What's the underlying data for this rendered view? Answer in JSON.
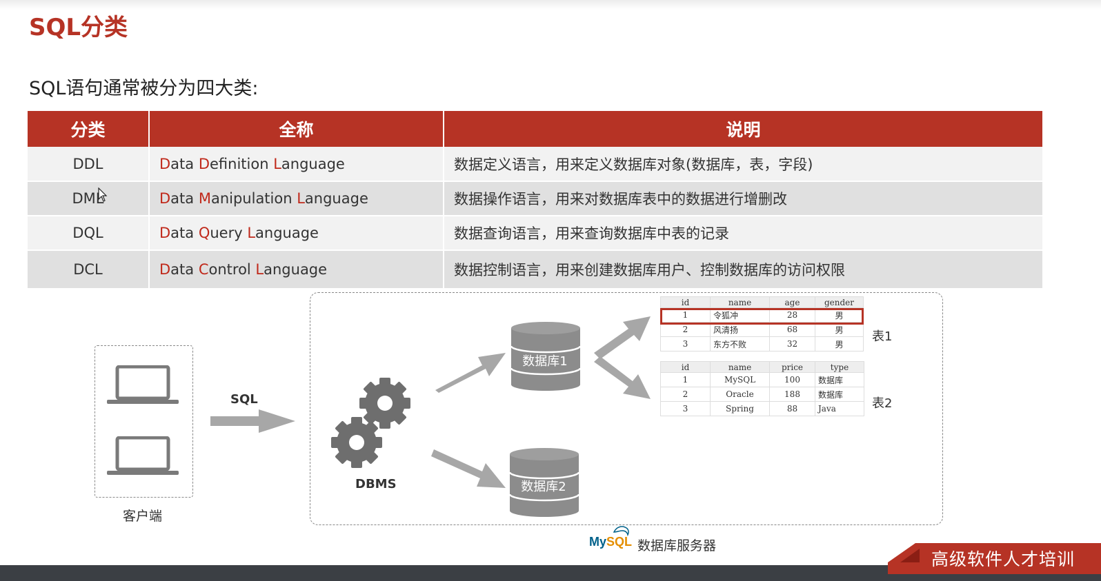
{
  "title": "SQL分类",
  "subtitle": "SQL语句通常被分为四大类:",
  "table": {
    "headers": [
      "分类",
      "全称",
      "说明"
    ],
    "rows": [
      {
        "abbr": "DDL",
        "w1a": "D",
        "w1b": "ata ",
        "w2a": "D",
        "w2b": "efinition ",
        "w3a": "L",
        "w3b": "anguage",
        "desc": "数据定义语言，用来定义数据库对象(数据库，表，字段)"
      },
      {
        "abbr": "DML",
        "w1a": "D",
        "w1b": "ata ",
        "w2a": "M",
        "w2b": "anipulation ",
        "w3a": "L",
        "w3b": "anguage",
        "desc": "数据操作语言，用来对数据库表中的数据进行增删改"
      },
      {
        "abbr": "DQL",
        "w1a": "D",
        "w1b": "ata ",
        "w2a": "Q",
        "w2b": "uery ",
        "w3a": "L",
        "w3b": "anguage",
        "desc": "数据查询语言，用来查询数据库中表的记录"
      },
      {
        "abbr": "DCL",
        "w1a": "D",
        "w1b": "ata ",
        "w2a": "C",
        "w2b": "ontrol ",
        "w3a": "L",
        "w3b": "anguage",
        "desc": "数据控制语言，用来创建数据库用户、控制数据库的访问权限"
      }
    ]
  },
  "diagram": {
    "client_label": "客户端",
    "sql_label": "SQL",
    "dbms_label": "DBMS",
    "db1_label": "数据库1",
    "db2_label": "数据库2",
    "table1": {
      "label": "表1",
      "headers": [
        "id",
        "name",
        "age",
        "gender"
      ],
      "rows": [
        [
          "1",
          "令狐冲",
          "28",
          "男"
        ],
        [
          "2",
          "风清扬",
          "68",
          "男"
        ],
        [
          "3",
          "东方不败",
          "32",
          "男"
        ]
      ]
    },
    "table2": {
      "label": "表2",
      "headers": [
        "id",
        "name",
        "price",
        "type"
      ],
      "rows": [
        [
          "1",
          "MySQL",
          "100",
          "数据库"
        ],
        [
          "2",
          "Oracle",
          "188",
          "数据库"
        ],
        [
          "3",
          "Spring",
          "88",
          "Java"
        ]
      ]
    },
    "mysql_logo_a": "My",
    "mysql_logo_b": "SQL",
    "server_label": "数据库服务器"
  },
  "banner_text": "高级软件人才培训"
}
